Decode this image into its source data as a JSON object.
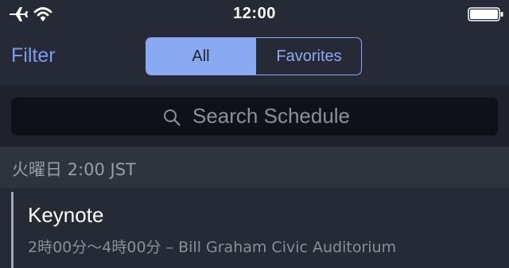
{
  "status_bar": {
    "time": "12:00",
    "icons": [
      "airplane-icon",
      "wifi-icon",
      "battery-icon"
    ]
  },
  "nav": {
    "filter_label": "Filter",
    "segments": [
      {
        "label": "All",
        "selected": true
      },
      {
        "label": "Favorites",
        "selected": false
      }
    ]
  },
  "search": {
    "placeholder": "Search Schedule",
    "icon": "search-icon"
  },
  "schedule": {
    "section_title": "火曜日 2:00 JST",
    "sessions": [
      {
        "title": "Keynote",
        "detail": "2時00分～4時00分 – Bill Graham Civic Auditorium"
      }
    ]
  },
  "colors": {
    "accent": "#89a9f3",
    "background": "#262a36",
    "search_field": "#0f1119",
    "section_header": "#2f333e"
  }
}
